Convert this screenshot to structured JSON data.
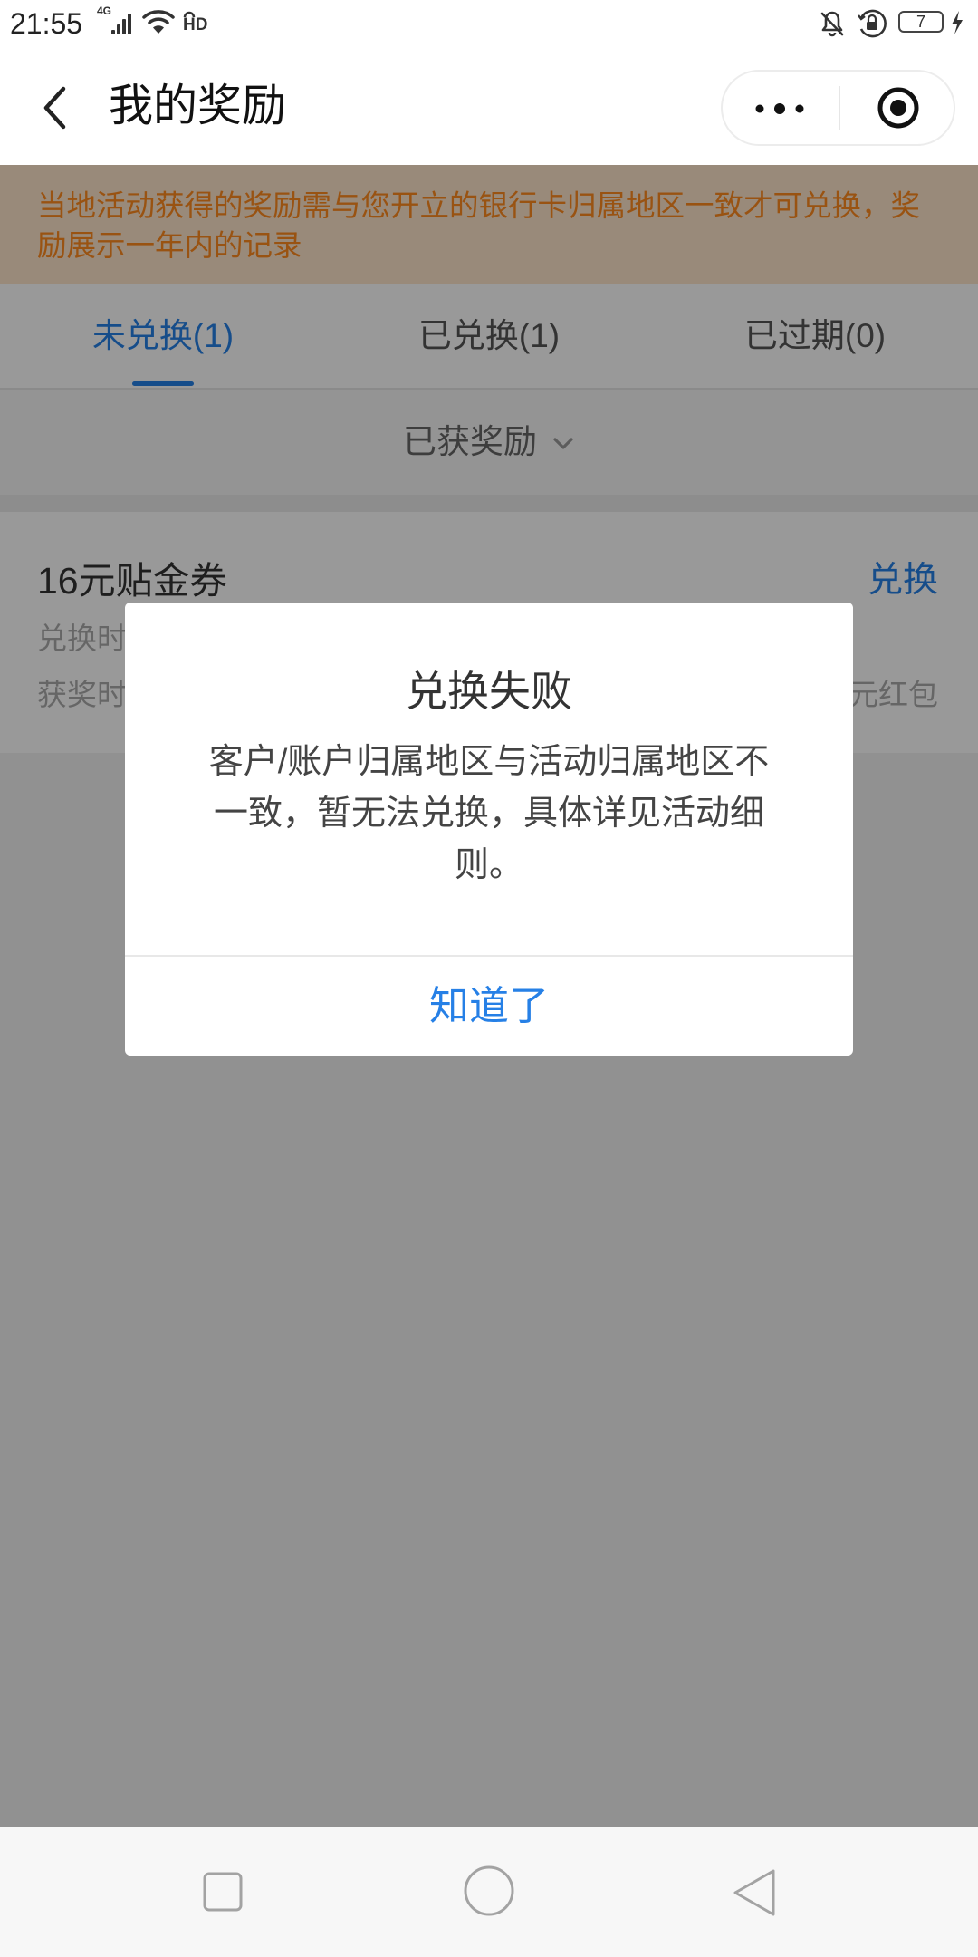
{
  "status_bar": {
    "time": "21:55",
    "network_type": "4G",
    "hd_label": "HD",
    "battery_level": "7",
    "icons": [
      "signal-icon",
      "wifi-icon",
      "hd-icon",
      "bell-off-icon",
      "rotation-lock-icon",
      "battery-icon",
      "charging-icon"
    ]
  },
  "nav": {
    "title": "我的奖励",
    "icons": [
      "chevron-left-icon",
      "more-icon",
      "target-icon"
    ]
  },
  "notice": {
    "text": "当地活动获得的奖励需与您开立的银行卡归属地区一致才可兑换，奖励展示一年内的记录"
  },
  "tabs": [
    {
      "label": "未兑换(1)",
      "active": true
    },
    {
      "label": "已兑换(1)",
      "active": false
    },
    {
      "label": "已过期(0)",
      "active": false
    }
  ],
  "filter": {
    "label": "已获奖励",
    "icon": "chevron-down-icon"
  },
  "reward": {
    "name": "16元贴金券",
    "action": "兑换",
    "exchange_time_label": "兑换时",
    "award_time_label": "获奖时",
    "prize_suffix": "元红包"
  },
  "dialog": {
    "title": "兑换失败",
    "message": "客户/账户归属地区与活动归属地区不一致，暂无法兑换，具体详见活动细则。",
    "confirm_label": "知道了"
  },
  "system_nav": {
    "icons": [
      "square-recent-icon",
      "circle-home-icon",
      "triangle-back-icon"
    ]
  },
  "colors": {
    "accent": "#2680e6",
    "notice_text": "#ff8a1f",
    "notice_bg": "#ffe6cc",
    "mask": "rgba(0,0,0,0.4)"
  }
}
